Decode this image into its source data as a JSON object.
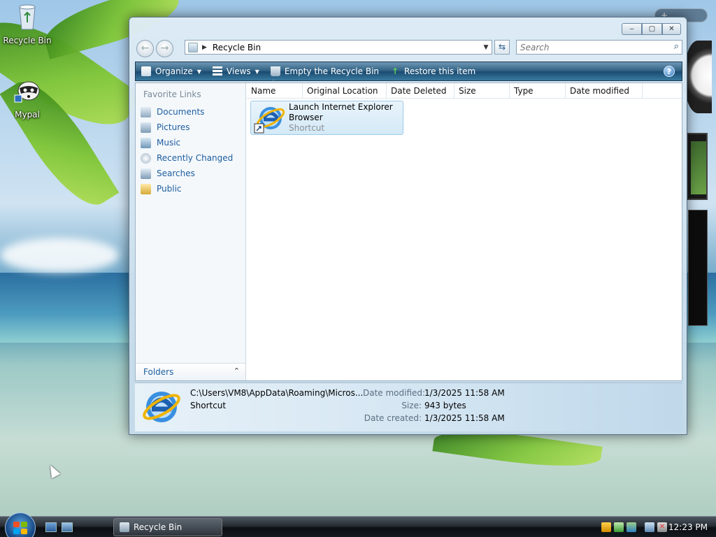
{
  "desktop": {
    "icons": [
      {
        "label": "Recycle Bin"
      },
      {
        "label": "Mypal"
      }
    ]
  },
  "window": {
    "address": {
      "location": "Recycle Bin"
    },
    "search": {
      "placeholder": "Search"
    },
    "toolbar": {
      "organize_label": "Organize",
      "views_label": "Views",
      "empty_label": "Empty the Recycle Bin",
      "restore_label": "Restore this item"
    },
    "navpane": {
      "header": "Favorite Links",
      "links": [
        {
          "label": "Documents"
        },
        {
          "label": "Pictures"
        },
        {
          "label": "Music"
        },
        {
          "label": "Recently Changed"
        },
        {
          "label": "Searches"
        },
        {
          "label": "Public"
        }
      ],
      "folders_label": "Folders"
    },
    "columns": [
      "Name",
      "Original Location",
      "Date Deleted",
      "Size",
      "Type",
      "Date modified"
    ],
    "items": [
      {
        "name": "Launch Internet Explorer Browser",
        "type": "Shortcut"
      }
    ],
    "details": {
      "path": "C:\\Users\\VM8\\AppData\\Roaming\\Micros...",
      "type": "Shortcut",
      "date_modified_label": "Date modified:",
      "date_modified": "1/3/2025 11:58 AM",
      "size_label": "Size:",
      "size": "943 bytes",
      "date_created_label": "Date created:",
      "date_created": "1/3/2025 11:58 AM"
    }
  },
  "taskbar": {
    "task_label": "Recycle Bin",
    "clock": "12:23 PM"
  },
  "colors": {
    "link": "#1f5ea0",
    "toolbar_dark": "#1b4b70",
    "selection": "#d4e9f7"
  }
}
